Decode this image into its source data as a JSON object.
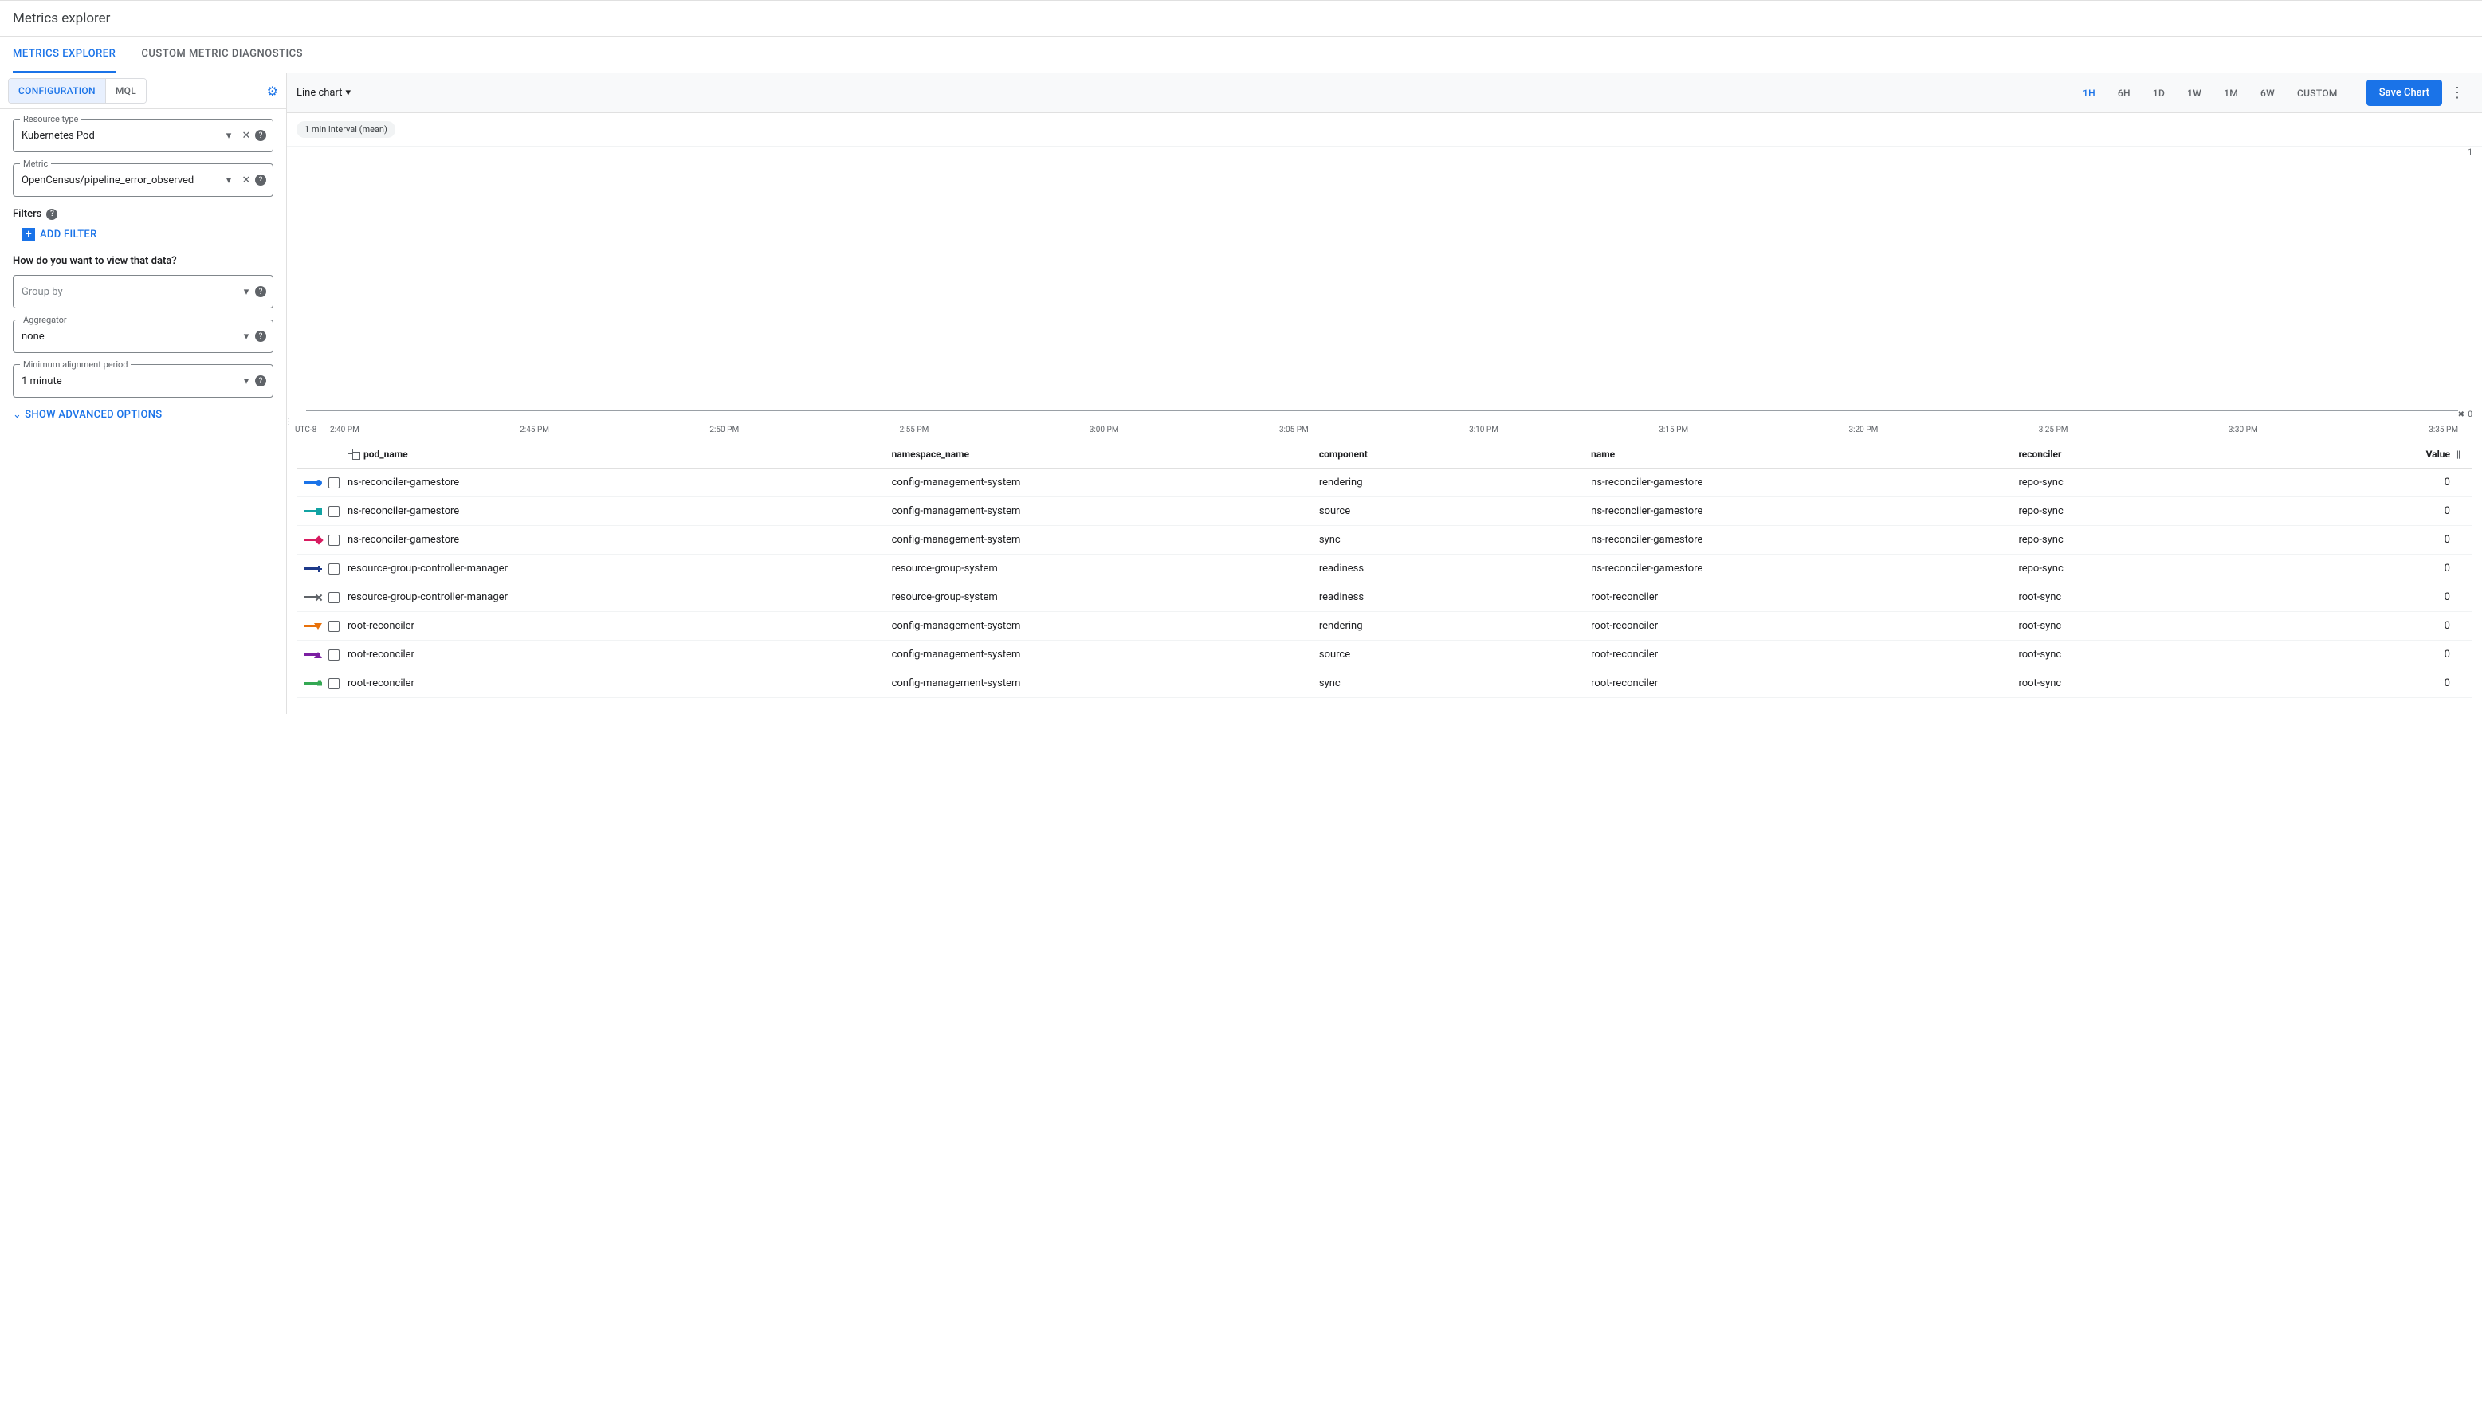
{
  "header": {
    "title": "Metrics explorer"
  },
  "tabs": [
    {
      "label": "METRICS EXPLORER",
      "active": true
    },
    {
      "label": "CUSTOM METRIC DIAGNOSTICS",
      "active": false
    }
  ],
  "sidebar": {
    "modes": [
      {
        "label": "CONFIGURATION",
        "active": true
      },
      {
        "label": "MQL",
        "active": false
      }
    ],
    "resource_type": {
      "label": "Resource type",
      "value": "Kubernetes Pod"
    },
    "metric": {
      "label": "Metric",
      "value": "OpenCensus/pipeline_error_observed"
    },
    "filters": {
      "label": "Filters",
      "add_label": "ADD FILTER"
    },
    "view_prompt": "How do you want to view that data?",
    "group_by": {
      "placeholder": "Group by"
    },
    "aggregator": {
      "label": "Aggregator",
      "value": "none"
    },
    "min_align": {
      "label": "Minimum alignment period",
      "value": "1 minute"
    },
    "advanced": "SHOW ADVANCED OPTIONS"
  },
  "toolbar": {
    "chart_type": "Line chart",
    "time_ranges": [
      "1H",
      "6H",
      "1D",
      "1W",
      "1M",
      "6W",
      "CUSTOM"
    ],
    "active_range": "1H",
    "save_chart": "Save Chart",
    "interval_chip": "1 min interval (mean)"
  },
  "chart_data": {
    "type": "line",
    "y_top": 1,
    "y_bottom": 0,
    "x_tz": "UTC-8",
    "x_ticks": [
      "2:40 PM",
      "2:45 PM",
      "2:50 PM",
      "2:55 PM",
      "3:00 PM",
      "3:05 PM",
      "3:10 PM",
      "3:15 PM",
      "3:20 PM",
      "3:25 PM",
      "3:30 PM",
      "3:35 PM"
    ],
    "note": "all series constant at 0",
    "series": [
      {
        "pod_name": "ns-reconciler-gamestore",
        "namespace_name": "config-management-system",
        "component": "rendering",
        "name": "ns-reconciler-gamestore",
        "reconciler": "repo-sync",
        "value": 0,
        "color": "#1a73e8",
        "marker": "circle"
      },
      {
        "pod_name": "ns-reconciler-gamestore",
        "namespace_name": "config-management-system",
        "component": "source",
        "name": "ns-reconciler-gamestore",
        "reconciler": "repo-sync",
        "value": 0,
        "color": "#12a3a3",
        "marker": "square"
      },
      {
        "pod_name": "ns-reconciler-gamestore",
        "namespace_name": "config-management-system",
        "component": "sync",
        "name": "ns-reconciler-gamestore",
        "reconciler": "repo-sync",
        "value": 0,
        "color": "#d81b60",
        "marker": "diamond"
      },
      {
        "pod_name": "resource-group-controller-manager",
        "namespace_name": "resource-group-system",
        "component": "readiness",
        "name": "ns-reconciler-gamestore",
        "reconciler": "repo-sync",
        "value": 0,
        "color": "#1e3a8a",
        "marker": "plus"
      },
      {
        "pod_name": "resource-group-controller-manager",
        "namespace_name": "resource-group-system",
        "component": "readiness",
        "name": "root-reconciler",
        "reconciler": "root-sync",
        "value": 0,
        "color": "#5f6368",
        "marker": "x"
      },
      {
        "pod_name": "root-reconciler",
        "namespace_name": "config-management-system",
        "component": "rendering",
        "name": "root-reconciler",
        "reconciler": "root-sync",
        "value": 0,
        "color": "#e8710a",
        "marker": "tri-down"
      },
      {
        "pod_name": "root-reconciler",
        "namespace_name": "config-management-system",
        "component": "source",
        "name": "root-reconciler",
        "reconciler": "root-sync",
        "value": 0,
        "color": "#7b1fa2",
        "marker": "tri-up"
      },
      {
        "pod_name": "root-reconciler",
        "namespace_name": "config-management-system",
        "component": "sync",
        "name": "root-reconciler",
        "reconciler": "root-sync",
        "value": 0,
        "color": "#34a853",
        "marker": "lock"
      }
    ]
  },
  "table": {
    "headers": {
      "pod_name": "pod_name",
      "namespace_name": "namespace_name",
      "component": "component",
      "name": "name",
      "reconciler": "reconciler",
      "value": "Value"
    }
  }
}
